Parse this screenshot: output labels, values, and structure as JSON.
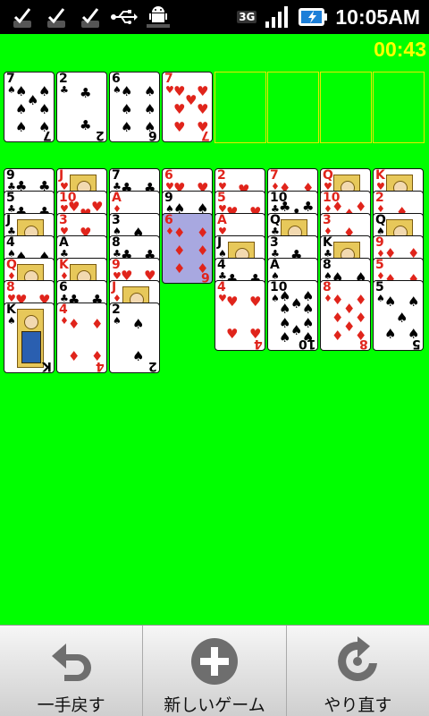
{
  "status_bar": {
    "time": "10:05AM",
    "network": "3G",
    "icons": [
      "sd-card-check-icon",
      "sd-card-check-icon",
      "sd-card-check-icon",
      "usb-icon",
      "android-icon",
      "signal-icon",
      "battery-charging-icon"
    ]
  },
  "game": {
    "timer": "00:43",
    "free_cells": [
      {
        "rank": "7",
        "suit": "♠",
        "color": "black"
      },
      {
        "rank": "2",
        "suit": "♣",
        "color": "black"
      },
      {
        "rank": "6",
        "suit": "♠",
        "color": "black"
      },
      {
        "rank": "7",
        "suit": "♥",
        "color": "red"
      }
    ],
    "foundations": 4,
    "columns": [
      [
        {
          "rank": "9",
          "suit": "♣",
          "color": "black"
        },
        {
          "rank": "5",
          "suit": "♣",
          "color": "black"
        },
        {
          "rank": "J",
          "suit": "♣",
          "color": "black",
          "face": true
        },
        {
          "rank": "4",
          "suit": "♠",
          "color": "black"
        },
        {
          "rank": "Q",
          "suit": "♦",
          "color": "red",
          "face": true
        },
        {
          "rank": "8",
          "suit": "♥",
          "color": "red"
        },
        {
          "rank": "K",
          "suit": "♠",
          "color": "black",
          "face": true
        }
      ],
      [
        {
          "rank": "J",
          "suit": "♥",
          "color": "red",
          "face": true
        },
        {
          "rank": "10",
          "suit": "♥",
          "color": "red"
        },
        {
          "rank": "3",
          "suit": "♥",
          "color": "red"
        },
        {
          "rank": "A",
          "suit": "♣",
          "color": "black"
        },
        {
          "rank": "K",
          "suit": "♦",
          "color": "red",
          "face": true
        },
        {
          "rank": "6",
          "suit": "♣",
          "color": "black"
        },
        {
          "rank": "4",
          "suit": "♦",
          "color": "red"
        }
      ],
      [
        {
          "rank": "7",
          "suit": "♣",
          "color": "black"
        },
        {
          "rank": "A",
          "suit": "♦",
          "color": "red"
        },
        {
          "rank": "3",
          "suit": "♠",
          "color": "black"
        },
        {
          "rank": "8",
          "suit": "♣",
          "color": "black"
        },
        {
          "rank": "9",
          "suit": "♥",
          "color": "red"
        },
        {
          "rank": "J",
          "suit": "♦",
          "color": "red",
          "face": true
        },
        {
          "rank": "2",
          "suit": "♠",
          "color": "black"
        }
      ],
      [
        {
          "rank": "6",
          "suit": "♥",
          "color": "red"
        },
        {
          "rank": "9",
          "suit": "♠",
          "color": "black"
        },
        {
          "rank": "6",
          "suit": "♦",
          "color": "red",
          "selected": true
        }
      ],
      [
        {
          "rank": "2",
          "suit": "♥",
          "color": "red"
        },
        {
          "rank": "5",
          "suit": "♥",
          "color": "red"
        },
        {
          "rank": "A",
          "suit": "♥",
          "color": "red"
        },
        {
          "rank": "J",
          "suit": "♠",
          "color": "black",
          "face": true
        },
        {
          "rank": "4",
          "suit": "♣",
          "color": "black"
        },
        {
          "rank": "4",
          "suit": "♥",
          "color": "red"
        }
      ],
      [
        {
          "rank": "7",
          "suit": "♦",
          "color": "red"
        },
        {
          "rank": "10",
          "suit": "♣",
          "color": "black"
        },
        {
          "rank": "Q",
          "suit": "♣",
          "color": "black",
          "face": true
        },
        {
          "rank": "3",
          "suit": "♣",
          "color": "black"
        },
        {
          "rank": "A",
          "suit": "♠",
          "color": "black"
        },
        {
          "rank": "10",
          "suit": "♠",
          "color": "black"
        }
      ],
      [
        {
          "rank": "Q",
          "suit": "♥",
          "color": "red",
          "face": true
        },
        {
          "rank": "10",
          "suit": "♦",
          "color": "red"
        },
        {
          "rank": "3",
          "suit": "♦",
          "color": "red"
        },
        {
          "rank": "K",
          "suit": "♣",
          "color": "black",
          "face": true
        },
        {
          "rank": "8",
          "suit": "♠",
          "color": "black"
        },
        {
          "rank": "8",
          "suit": "♦",
          "color": "red"
        }
      ],
      [
        {
          "rank": "K",
          "suit": "♥",
          "color": "red",
          "face": true
        },
        {
          "rank": "2",
          "suit": "♦",
          "color": "red"
        },
        {
          "rank": "Q",
          "suit": "♠",
          "color": "black",
          "face": true
        },
        {
          "rank": "9",
          "suit": "♦",
          "color": "red"
        },
        {
          "rank": "5",
          "suit": "♦",
          "color": "red"
        },
        {
          "rank": "5",
          "suit": "♠",
          "color": "black"
        }
      ]
    ]
  },
  "toolbar": {
    "undo_label": "一手戻す",
    "new_game_label": "新しいゲーム",
    "redo_label": "やり直す"
  },
  "colors": {
    "felt": "#00ff00",
    "timer": "#ffff00",
    "red_suit": "#e0241b",
    "selected": "#a8a8e0"
  }
}
